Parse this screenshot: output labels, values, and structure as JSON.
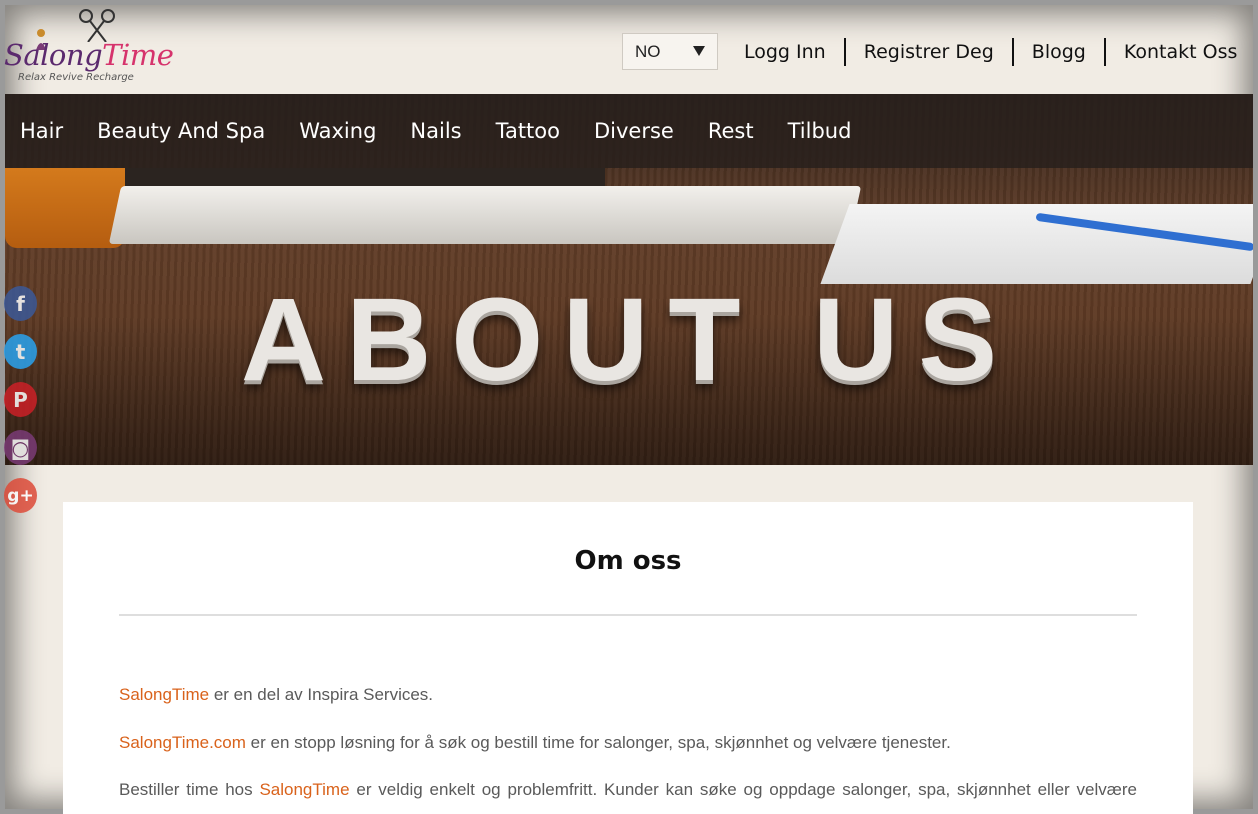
{
  "header": {
    "logo": {
      "word_part1": "Salong",
      "word_part2": "Time",
      "tagline": "Relax Revive Recharge"
    },
    "language": {
      "selected": "NO"
    },
    "links": [
      "Logg Inn",
      "Registrer Deg",
      "Blogg",
      "Kontakt Oss"
    ]
  },
  "nav": {
    "items": [
      "Hair",
      "Beauty And Spa",
      "Waxing",
      "Nails",
      "Tattoo",
      "Diverse",
      "Rest",
      "Tilbud"
    ]
  },
  "hero": {
    "title": "ABOUT US"
  },
  "social": {
    "icons": [
      "facebook-icon",
      "twitter-icon",
      "pinterest-icon",
      "instagram-icon",
      "google-plus-icon"
    ],
    "glyphs": {
      "facebook": "f",
      "twitter": "t",
      "pinterest": "P",
      "instagram": "◙",
      "googleplus": "g+"
    }
  },
  "content": {
    "title": "Om oss",
    "p1": {
      "brand": "SalongTime",
      "text": " er en del av Inspira Services."
    },
    "p2": {
      "brand": "SalongTime.com",
      "text": " er en stopp løsning for å søk og bestill time for salonger, spa, skjønnhet og velvære tjenester."
    },
    "p3": {
      "before": "Bestiller time hos ",
      "brand": "SalongTime",
      "text": " er veldig enkelt og problemfritt. Kunder kan søke og oppdage salonger, spa, skjønnhet eller velvære"
    }
  },
  "colors": {
    "brand_orange": "#d9621b",
    "nav_bg": "#28201c",
    "page_bg": "#f1ece4",
    "logo_purple": "#5b2a6e",
    "logo_pink": "#d6336c"
  }
}
